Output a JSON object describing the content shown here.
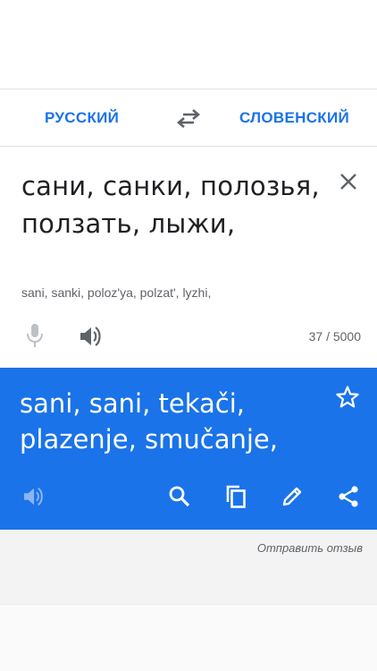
{
  "language_bar": {
    "source_language": "РУССКИЙ",
    "target_language": "СЛОВЕНСКИЙ",
    "swap_icon": "swap-arrows-icon"
  },
  "input": {
    "text": "сани, санки, полозья, ползать, лыжи,",
    "transliteration": "sani, sanki, poloz'ya, polzat', lyzhi,",
    "char_count": "37 / 5000",
    "icons": [
      "close-icon",
      "microphone-icon",
      "speaker-icon"
    ]
  },
  "output": {
    "text": "sani, sani, tekači, plazenje, smučanje,",
    "icons": [
      "star-icon",
      "speaker-icon",
      "search-icon",
      "copy-icon",
      "edit-pencil-icon",
      "share-icon"
    ]
  },
  "feedback": {
    "label": "Отправить отзыв"
  },
  "colors": {
    "accent": "#1a73e8",
    "text_primary": "#202124",
    "text_secondary": "#5f6368"
  }
}
